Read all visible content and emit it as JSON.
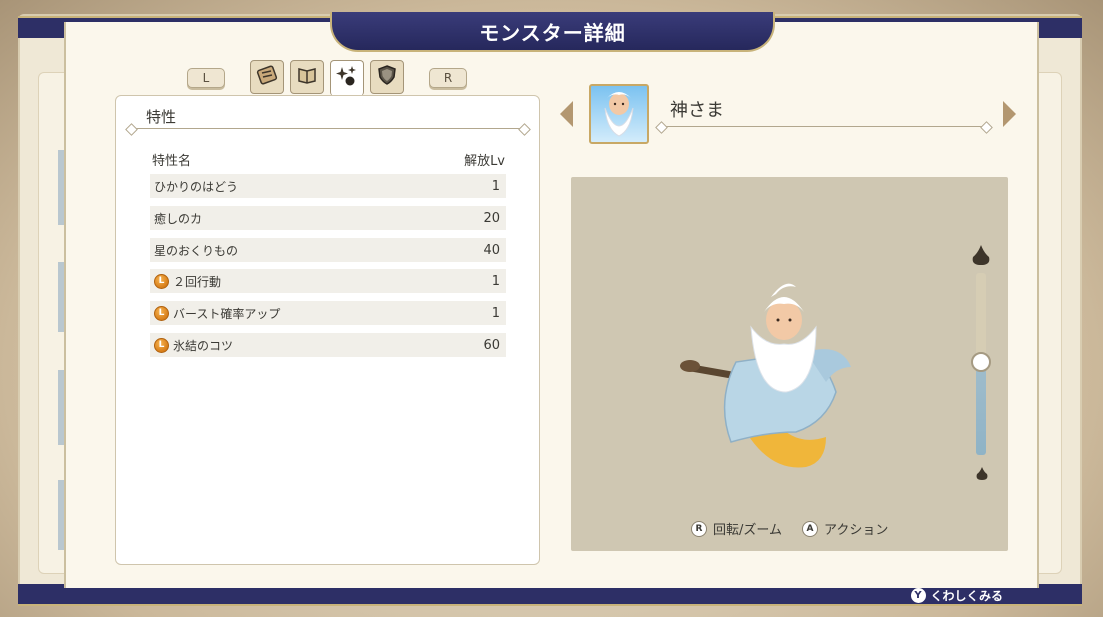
{
  "screen": {
    "title": "モンスター詳細",
    "footer_button": "Y",
    "footer_hint": "くわしくみる"
  },
  "tabs": {
    "left_shoulder": "L",
    "right_shoulder": "R",
    "items": [
      {
        "icon": "scroll-icon"
      },
      {
        "icon": "book-icon"
      },
      {
        "icon": "sparkle-icon",
        "active": true
      },
      {
        "icon": "shield-icon"
      }
    ]
  },
  "traits": {
    "title": "特性",
    "col_name": "特性名",
    "col_level": "解放Lv",
    "rows": [
      {
        "name": "ひかりのはどう",
        "level": "1",
        "leader": false
      },
      {
        "name": "癒しのカ",
        "level": "20",
        "leader": false
      },
      {
        "name": "星のおくりもの",
        "level": "40",
        "leader": false
      },
      {
        "name": "２回行動",
        "level": "1",
        "leader": true
      },
      {
        "name": "バースト確率アップ",
        "level": "1",
        "leader": true
      },
      {
        "name": "氷結のコツ",
        "level": "60",
        "leader": true
      }
    ],
    "leader_badge": "L"
  },
  "monster": {
    "name": "神さま",
    "zoom_level": 0.5
  },
  "viewer_hints": {
    "rotate_button": "R",
    "rotate_label": "回転/ズーム",
    "action_button": "A",
    "action_label": "アクション"
  },
  "colors": {
    "navy": "#2d2f66",
    "gold": "#c8b37a",
    "leader_orange": "#d77d18"
  }
}
